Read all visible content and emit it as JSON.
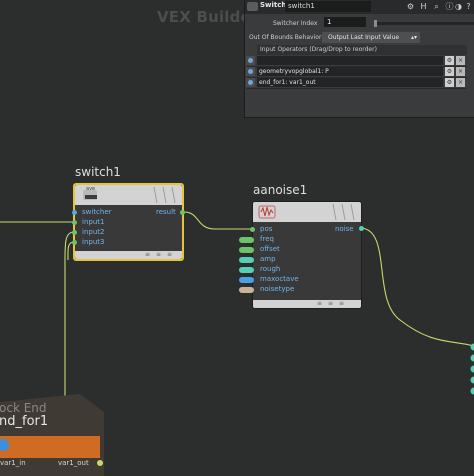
{
  "context_title": "VEX Builder",
  "parm_panel": {
    "node_type": "Switch",
    "node_name": "switch1",
    "switcher_index_label": "Switcher Index",
    "switcher_index_value": "1",
    "out_of_bounds_label": "Out Of Bounds Behavior",
    "out_of_bounds_value": "Output Last Input Value",
    "input_operators_header": "Input Operators (Drag/Drop to reorder)",
    "input_rows": [
      "",
      "geometryvopglobal1: P",
      "end_for1: var1_out"
    ],
    "icons": [
      "gear-icon",
      "help-icon",
      "search-icon",
      "info-icon",
      "hidden-icon",
      "help-question-icon"
    ],
    "icon_glyphs": [
      "⚙",
      "H",
      "⌕",
      "ⓘ",
      "◑",
      "?"
    ]
  },
  "switch_node": {
    "name": "switch1",
    "inputs": [
      "switcher",
      "input1",
      "input2",
      "input3"
    ],
    "output": "result",
    "header_badge": "ave"
  },
  "aanoise_node": {
    "name": "aanoise1",
    "inputs": [
      "pos",
      "freq",
      "offset",
      "amp",
      "rough",
      "maxoctave",
      "noisetype"
    ],
    "input_colors": [
      "#6cc46a",
      "#6cc46a",
      "#6cc46a",
      "#55d0b5",
      "#55d0b5",
      "#4aa0e6",
      "#c9b497"
    ],
    "output": "noise"
  },
  "block_end_node": {
    "title": "ock End",
    "name": "nd_for1",
    "input": "var1_in",
    "output": "var1_out",
    "accent": "#d06a1f"
  }
}
